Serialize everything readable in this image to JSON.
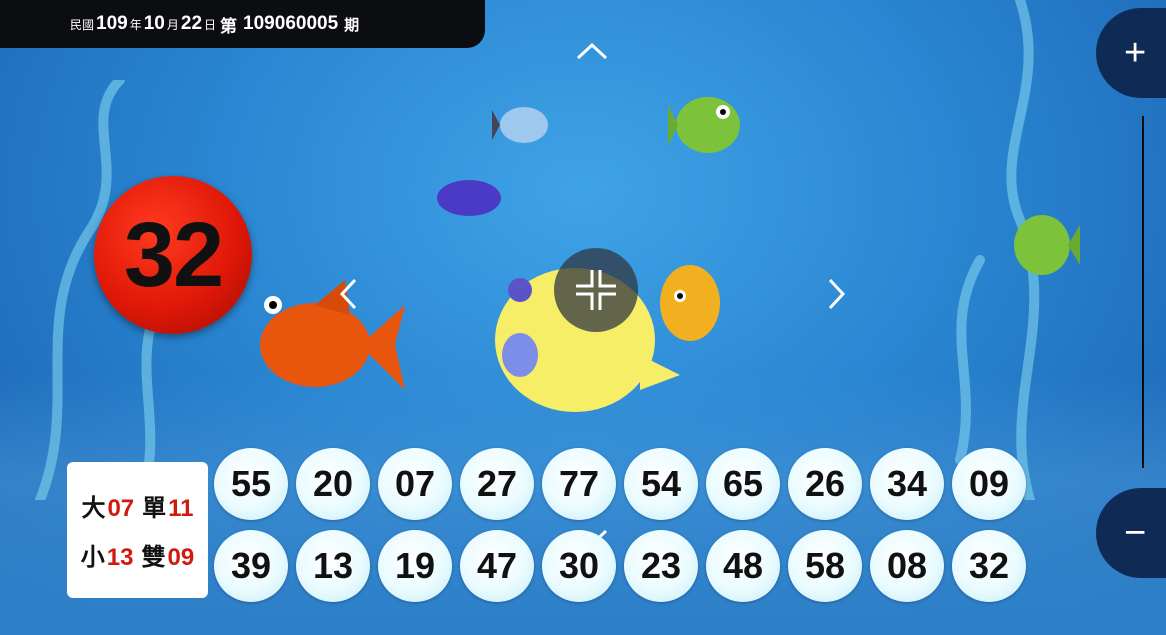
{
  "header": {
    "era": "民國",
    "year": "109",
    "year_unit": "年",
    "month": "10",
    "month_unit": "月",
    "day": "22",
    "day_unit": "日",
    "draw_prefix": "第",
    "draw_number": "109060005",
    "draw_suffix": "期"
  },
  "current_ball": "32",
  "stats": {
    "big_label": "大",
    "big_value": "07",
    "odd_label": "單",
    "odd_value": "11",
    "small_label": "小",
    "small_value": "13",
    "even_label": "雙",
    "even_value": "09"
  },
  "balls": [
    "55",
    "20",
    "07",
    "27",
    "77",
    "54",
    "65",
    "26",
    "34",
    "09",
    "39",
    "13",
    "19",
    "47",
    "30",
    "23",
    "48",
    "58",
    "08",
    "32"
  ],
  "controls": {
    "zoom_in": "+",
    "zoom_out": "−"
  },
  "colors": {
    "current_ball": "#e01808",
    "stat_value": "#d01a10",
    "ocean": "#2a86d2"
  }
}
